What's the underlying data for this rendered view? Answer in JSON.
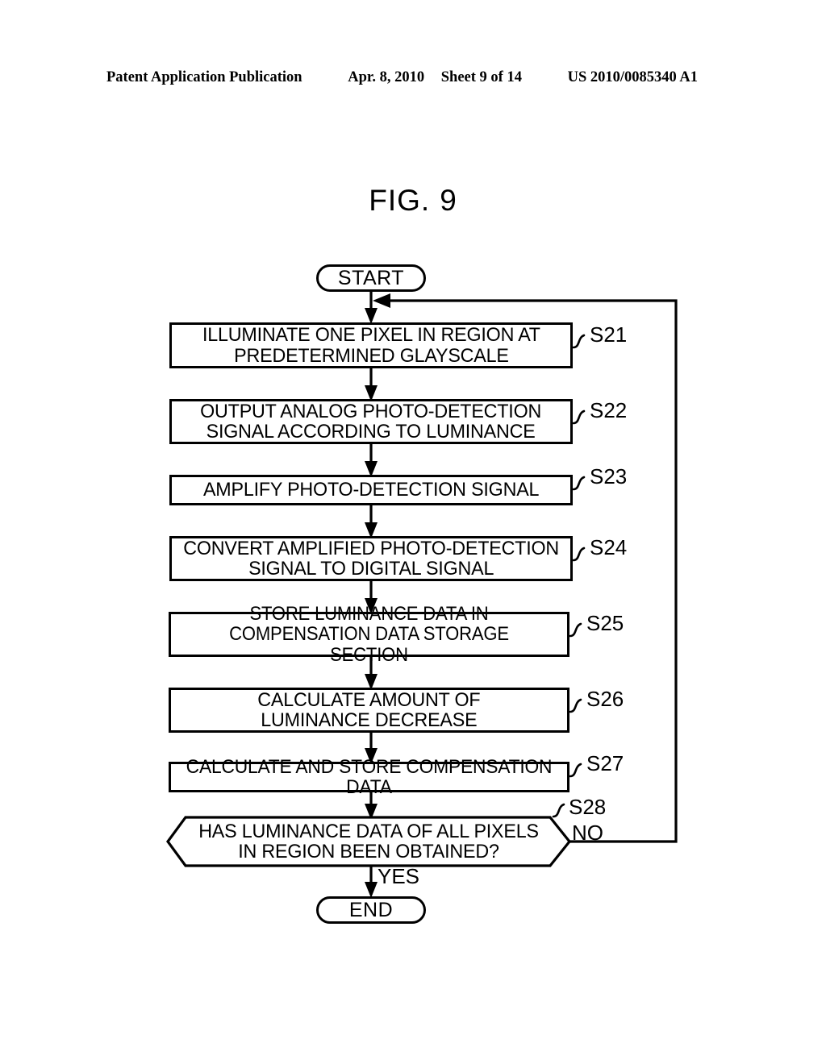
{
  "header": {
    "publication": "Patent Application Publication",
    "date": "Apr. 8, 2010",
    "sheet": "Sheet 9 of 14",
    "patent_number": "US 2010/0085340 A1"
  },
  "figure": {
    "label": "FIG.",
    "number": "9"
  },
  "flowchart": {
    "start_label": "START",
    "end_label": "END",
    "steps": [
      {
        "ref": "S21",
        "text": "ILLUMINATE ONE PIXEL IN REGION AT\nPREDETERMINED GLAYSCALE"
      },
      {
        "ref": "S22",
        "text": "OUTPUT ANALOG PHOTO-DETECTION\nSIGNAL ACCORDING TO LUMINANCE"
      },
      {
        "ref": "S23",
        "text": "AMPLIFY PHOTO-DETECTION SIGNAL"
      },
      {
        "ref": "S24",
        "text": "CONVERT AMPLIFIED PHOTO-DETECTION\nSIGNAL TO DIGITAL SIGNAL"
      },
      {
        "ref": "S25",
        "text": "STORE LUMINANCE DATA IN\nCOMPENSATION DATA STORAGE SECTION"
      },
      {
        "ref": "S26",
        "text": "CALCULATE AMOUNT OF\nLUMINANCE DECREASE"
      },
      {
        "ref": "S27",
        "text": "CALCULATE AND STORE COMPENSATION DATA"
      }
    ],
    "decision": {
      "ref": "S28",
      "text": "HAS LUMINANCE DATA OF ALL PIXELS\nIN REGION BEEN OBTAINED?",
      "branch_no": "NO",
      "branch_yes": "YES"
    },
    "colors": {
      "line": "#000000",
      "fill": "#ffffff",
      "text": "#000000"
    }
  }
}
